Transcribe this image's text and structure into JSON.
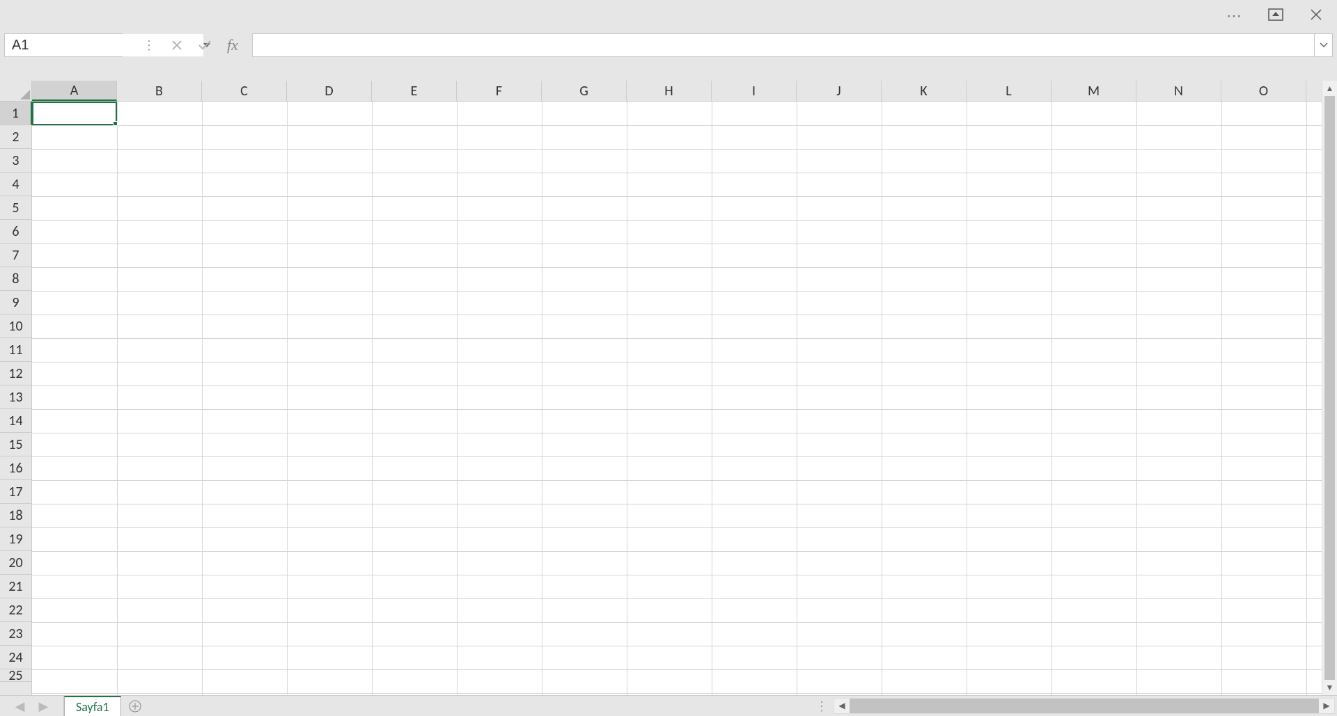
{
  "titlebar": {
    "options_label": "⋯",
    "ribbon_options_label": "▣",
    "close_label": "✕"
  },
  "formula_bar": {
    "name_box_value": "A1",
    "formula_value": "",
    "cancel_label": "✕",
    "enter_label": "✓",
    "fx_label": "fx",
    "expand_label": "˅"
  },
  "grid": {
    "columns": [
      "A",
      "B",
      "C",
      "D",
      "E",
      "F",
      "G",
      "H",
      "I",
      "J",
      "K",
      "L",
      "M",
      "N",
      "O"
    ],
    "rows": [
      "1",
      "2",
      "3",
      "4",
      "5",
      "6",
      "7",
      "8",
      "9",
      "10",
      "11",
      "12",
      "13",
      "14",
      "15",
      "16",
      "17",
      "18",
      "19",
      "20",
      "21",
      "22",
      "23",
      "24",
      "25"
    ],
    "active_cell": "A1",
    "selected_column_index": 0,
    "selected_row_index": 0
  },
  "sheet_bar": {
    "prev_label": "◀",
    "next_label": "▶",
    "active_tab": "Sayfa1",
    "add_label": "⊕"
  },
  "scroll": {
    "up_label": "▲",
    "down_label": "▼",
    "left_label": "◀",
    "right_label": "▶"
  }
}
